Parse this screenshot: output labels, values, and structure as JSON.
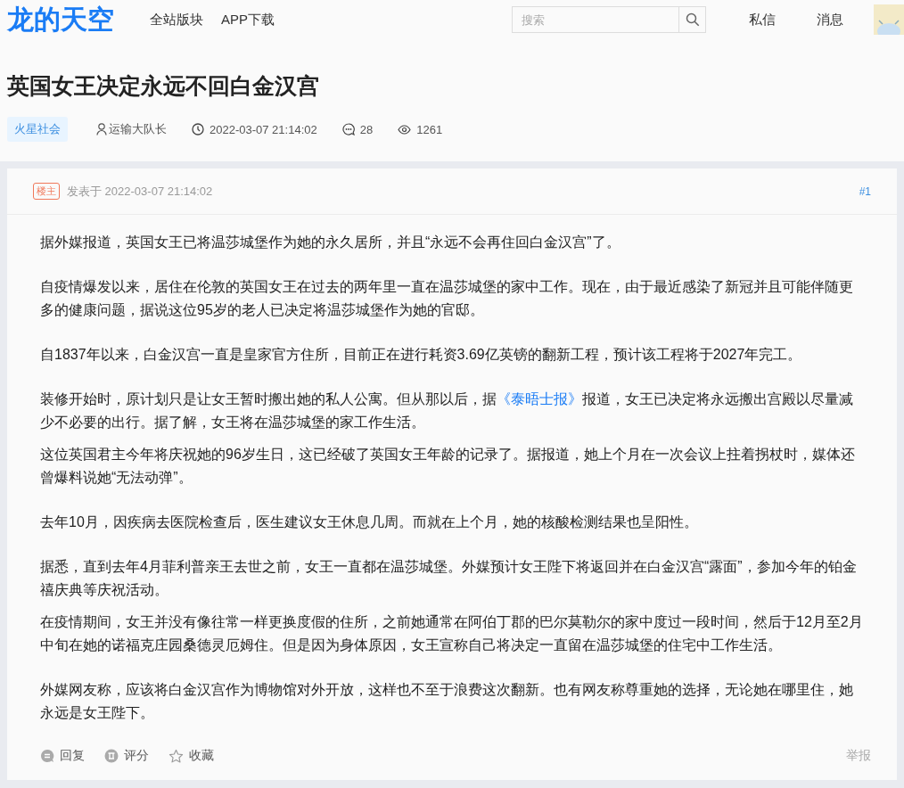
{
  "header": {
    "logo": "龙的天空",
    "nav": [
      "全站版块",
      "APP下载"
    ],
    "search": {
      "placeholder": "搜索"
    },
    "links": [
      "私信",
      "消息"
    ]
  },
  "article": {
    "title": "英国女王决定永远不回白金汉宫",
    "board": "火星社会",
    "author": "运输大队长",
    "time": "2022-03-07 21:14:02",
    "comments": "28",
    "views": "1261"
  },
  "post": {
    "badge": "楼主",
    "posted": "发表于 2022-03-07 21:14:02",
    "floor": "#1",
    "paragraph_groups": [
      [
        [
          {
            "kind": "text",
            "text": "据外媒报道，英国女王已将温莎城堡作为她的永久居所，并且“永远不会再住回白金汉宫”了。"
          }
        ]
      ],
      [
        [
          {
            "kind": "text",
            "text": "自疫情爆发以来，居住在伦敦的英国女王在过去的两年里一直在温莎城堡的家中工作。现在，由于最近感染了新冠并且可能伴随更多的健康问题，据说这位95岁的老人已决定将温莎城堡作为她的官邸。"
          }
        ]
      ],
      [
        [
          {
            "kind": "text",
            "text": "自1837年以来，白金汉宫一直是皇家官方住所，目前正在进行耗资3.69亿英镑的翻新工程，预计该工程将于2027年完工。"
          }
        ]
      ],
      [
        [
          {
            "kind": "text",
            "text": "装修开始时，原计划只是让女王暂时搬出她的私人公寓。但从那以后，据"
          },
          {
            "kind": "link",
            "text": "《泰晤士报》"
          },
          {
            "kind": "text",
            "text": "报道，女王已决定将永远搬出宫殿以尽量减少不必要的出行。据了解，女王将在温莎城堡的家工作生活。"
          }
        ],
        [
          {
            "kind": "text",
            "text": "这位英国君主今年将庆祝她的96岁生日，这已经破了英国女王年龄的记录了。据报道，她上个月在一次会议上拄着拐杖时，媒体还曾爆料说她“无法动弹”。"
          }
        ]
      ],
      [
        [
          {
            "kind": "text",
            "text": "去年10月，因疾病去医院检查后，医生建议女王休息几周。而就在上个月，她的核酸检测结果也呈阳性。"
          }
        ]
      ],
      [
        [
          {
            "kind": "text",
            "text": "据悉，直到去年4月菲利普亲王去世之前，女王一直都在温莎城堡。外媒预计女王陛下将返回并在白金汉宫“露面”，参加今年的铂金禧庆典等庆祝活动。"
          }
        ],
        [
          {
            "kind": "text",
            "text": "在疫情期间，女王并没有像往常一样更换度假的住所，之前她通常在阿伯丁郡的巴尔莫勒尔的家中度过一段时间，然后于12月至2月中旬在她的诺福克庄园桑德灵厄姆住。但是因为身体原因，女王宣称自己将决定一直留在温莎城堡的住宅中工作生活。"
          }
        ]
      ],
      [
        [
          {
            "kind": "text",
            "text": "外媒网友称，应该将白金汉宫作为博物馆对外开放，这样也不至于浪费这次翻新。也有网友称尊重她的选择，无论她在哪里住，她永远是女王陛下。"
          }
        ]
      ]
    ],
    "actions": [
      {
        "kind": "reply",
        "label": "回复"
      },
      {
        "kind": "rate",
        "label": "评分"
      },
      {
        "kind": "favorite",
        "label": "收藏"
      }
    ],
    "report": "举报"
  }
}
